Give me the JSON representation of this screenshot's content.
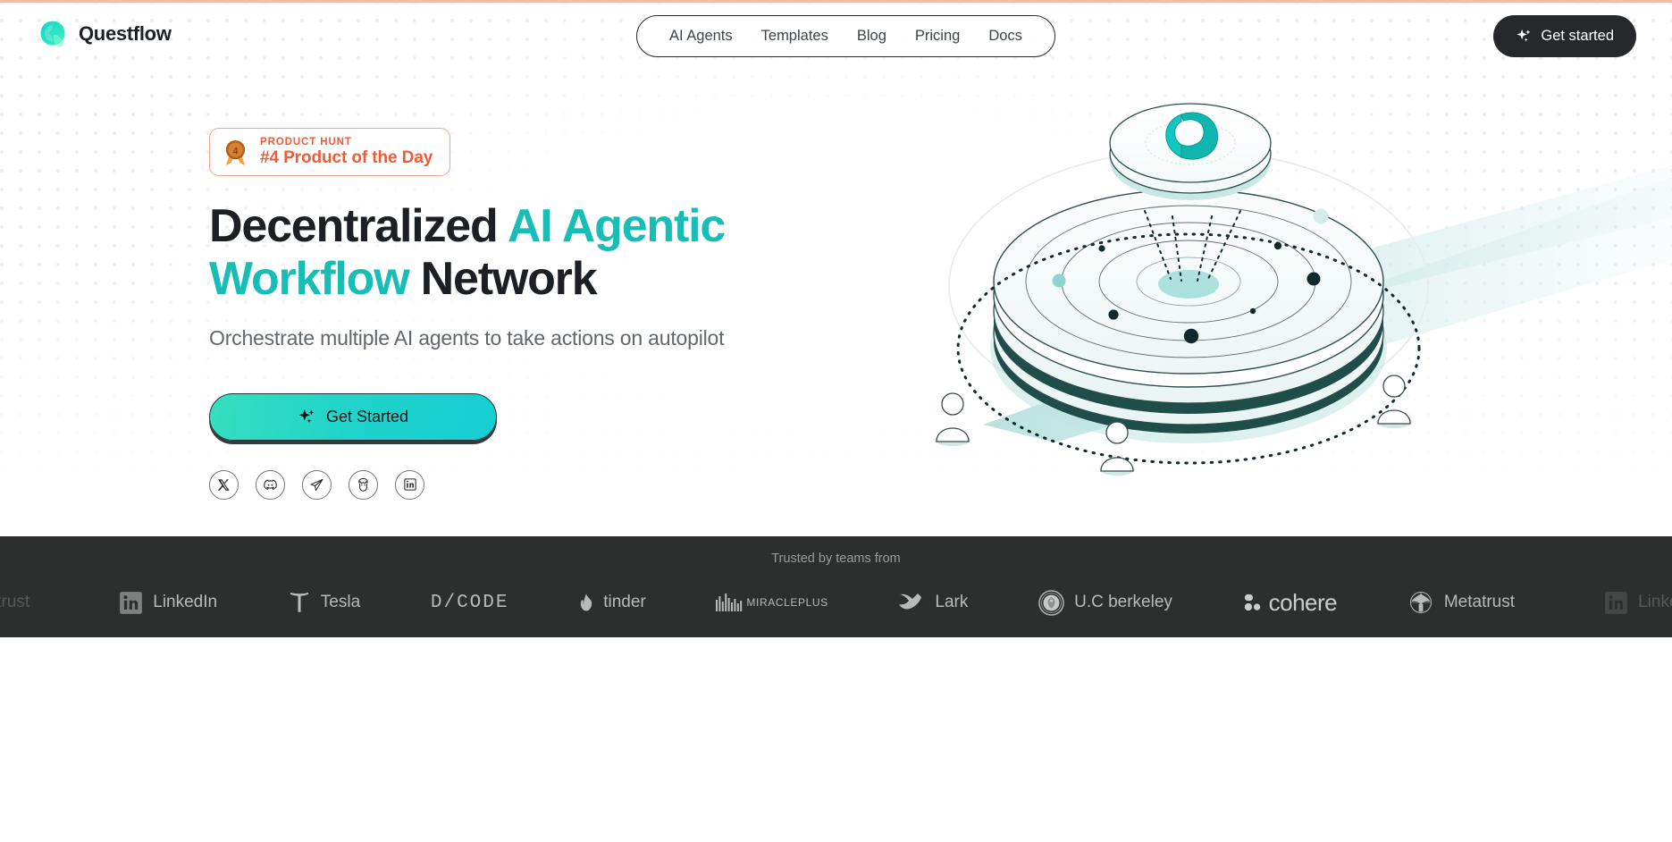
{
  "header": {
    "brand_name": "Questflow",
    "brand_icon": "questflow-logo-icon",
    "nav_items": [
      {
        "label": "AI Agents"
      },
      {
        "label": "Templates"
      },
      {
        "label": "Blog"
      },
      {
        "label": "Pricing"
      },
      {
        "label": "Docs"
      }
    ],
    "cta_label": "Get started",
    "cta_icon": "sparkles-icon"
  },
  "hero": {
    "badge": {
      "icon": "product-hunt-medal-icon",
      "medal_number": "4",
      "kicker": "PRODUCT HUNT",
      "title": "#4 Product of the Day"
    },
    "headline_part1": "Decentralized ",
    "headline_accent": "AI Agentic Workflow",
    "headline_part2": " Network",
    "subhead": "Orchestrate multiple AI agents to take actions on autopilot",
    "cta_label": "Get Started",
    "cta_icon": "sparkles-icon",
    "socials": [
      {
        "name": "x-twitter-icon",
        "label": "X"
      },
      {
        "name": "discord-icon",
        "label": "Discord"
      },
      {
        "name": "telegram-icon",
        "label": "Telegram"
      },
      {
        "name": "farcaster-icon",
        "label": "Farcaster"
      },
      {
        "name": "linkedin-icon",
        "label": "LinkedIn"
      }
    ],
    "illustration": "isometric-agent-network-platform"
  },
  "trusted": {
    "label": "Trusted by teams from",
    "logos": [
      {
        "label": "Metatrust",
        "icon": "metatrust-icon",
        "faded": true
      },
      {
        "label": "LinkedIn",
        "icon": "linkedin-square-icon",
        "faded": false
      },
      {
        "label": "Tesla",
        "icon": "tesla-icon",
        "faded": false
      },
      {
        "label": "D/CODE",
        "icon": "dcode-wordmark-icon",
        "faded": false
      },
      {
        "label": "tinder",
        "icon": "tinder-flame-icon",
        "faded": false
      },
      {
        "label": "MIRACLEPLUS",
        "icon": "miracleplus-bars-icon",
        "faded": false
      },
      {
        "label": "Lark",
        "icon": "lark-bird-icon",
        "faded": false
      },
      {
        "label": "U.C berkeley",
        "icon": "uc-berkeley-seal-icon",
        "faded": false
      },
      {
        "label": "cohere",
        "icon": "cohere-icon",
        "faded": false
      },
      {
        "label": "Metatrust",
        "icon": "metatrust-eagle-icon",
        "faded": false
      },
      {
        "label": "LinkedIn",
        "icon": "linkedin-square-icon",
        "faded": true
      }
    ]
  },
  "colors": {
    "accent_teal": "#18bdb6",
    "brand_dark": "#1c2024",
    "product_hunt_orange": "#f05b35",
    "trusted_bar_bg": "#2d2e2e",
    "top_accent_line": "#f7b9ab"
  }
}
